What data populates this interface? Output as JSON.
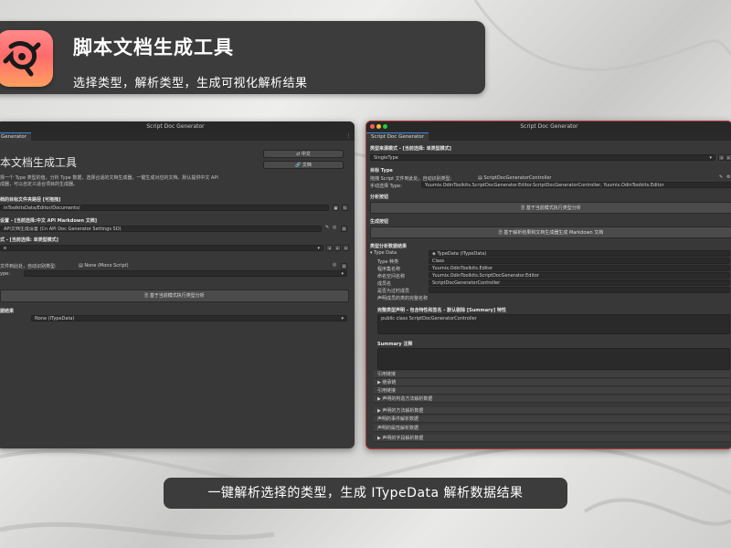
{
  "banner": {
    "title": "脚本文档生成工具",
    "subtitle": "选择类型，解析类型，生成可视化解析结果"
  },
  "caption": "一键解析选择的类型，生成 ITypeData 解析数据结果",
  "left_window": {
    "title": "Script Doc Generator",
    "tab": "Generator",
    "heading": "本文档生成工具",
    "desc_line1": "择一个 Type 类型的值，分析 Type 数据，选择合适的文档生成器，一键生成对应的文档。默认提供中文 API",
    "desc_line2": "成器，可以自定义适合项目的生成器。",
    "btn_cn": "中文",
    "btn_doc": "文档",
    "target_folder_label": "档的目标文件夹路径 [可拖拽]",
    "target_folder_value": "inToolkitsData/Editor/Documents/",
    "generator_settings_label": "设置 - [当前选择:中文 API Markdown 文档]",
    "generator_settings_value": "API文档生成设置 (Cn API Doc Generator Settings SO)",
    "mode_label": "式 - [当前选择: 单类型模式]",
    "mode_value": "e",
    "drag_hint": "文件到此处，自动识别类型:",
    "drag_value": "None (Mono Script)",
    "type_label": "ype:",
    "analyze_button": "基于当前模式执行类型分析",
    "result_label": "据结果",
    "result_value": "None (ITypeData)"
  },
  "right_window": {
    "title": "Script Doc Generator",
    "tab": "Script Doc Generator",
    "source_mode_label": "类型来源模式 - [当前选择: 单类型模式]",
    "source_mode_value": "SingleType",
    "target_type_label": "目标 Type",
    "drag_hint": "拖拽 Script 文件到此处，自动识别类型:",
    "drag_value": "ScriptDocGeneratorController",
    "manual_label": "手动选择 Type:",
    "manual_value": "Yuumix.OdinToolkits.ScriptDocGenerator.Editor.ScriptDocGeneratorController, Yuumix.OdinToolkits.Editor",
    "analyze_section": "分析按钮",
    "analyze_button": "基于当前模式执行类型分析",
    "generate_section": "生成按钮",
    "generate_button": "基于解析结果和文档生成器生成 Markdown 文档",
    "result_section": "类型分析数据结果",
    "type_data_label": "Type Data",
    "type_data_value": "TypeData (ITypeData)",
    "props": [
      {
        "label": "Type 种类",
        "value": "Class"
      },
      {
        "label": "程序集名称",
        "value": "Yuumix.OdinToolkits.Editor"
      },
      {
        "label": "命名空间名称",
        "value": "Yuumix.OdinToolkits.ScriptDocGenerator.Editor"
      },
      {
        "label": "成员名",
        "value": "ScriptDocGeneratorController"
      },
      {
        "label": "是否为过时成员",
        "value": ""
      },
      {
        "label": "声明成员的类的完整名称",
        "value": ""
      }
    ],
    "full_decl_label": "完整类型声明 - 包含特性和签名 - 默认剔除 [Summary] 特性",
    "full_decl_value": "public class ScriptDocGeneratorController",
    "summary_label": "Summary 注释",
    "foldouts": [
      "引用链接",
      "▶ 继承链",
      "引用链接",
      "▶ 声明的构造方法解析数据",
      "▶ 声明的方法解析数据",
      "声明的事件解析数据",
      "声明的属性解析数据",
      "▶ 声明的字段解析数据"
    ]
  },
  "colors": {
    "window_bg": "#383838",
    "accent_red": "#b23a3a",
    "tab_accent": "#3d86d4",
    "icon_gradient_top": "#ff8a8a",
    "icon_gradient_bottom": "#ff9f60"
  }
}
